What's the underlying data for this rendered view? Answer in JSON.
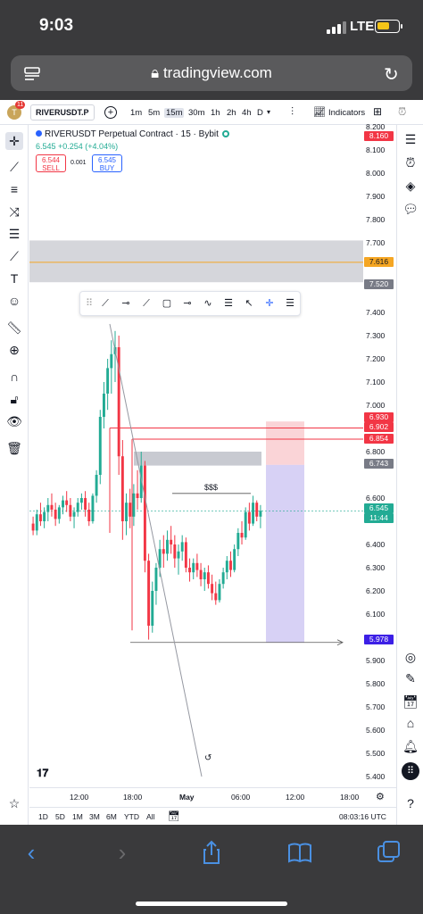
{
  "status_bar": {
    "time": "9:03",
    "network": "LTE"
  },
  "browser": {
    "url": "tradingview.com"
  },
  "toolbar": {
    "notifications": "11",
    "symbol": "RIVERUSDT.P",
    "timeframes": [
      "1m",
      "5m",
      "15m",
      "30m",
      "1h",
      "2h",
      "4h",
      "D"
    ],
    "active_timeframe": "15m",
    "indicators_label": "Indicators"
  },
  "legend": {
    "title": "RIVERUSDT Perpetual Contract · 15 · Bybit",
    "change": "6.545 +0.254 (+4.04%)",
    "sell_price": "6.544",
    "sell_label": "SELL",
    "spread": "0.001",
    "buy_price": "6.545",
    "buy_label": "BUY"
  },
  "price_axis": {
    "ticks": [
      "8.200",
      "8.100",
      "8.000",
      "7.900",
      "7.800",
      "7.700",
      "7.400",
      "7.300",
      "7.200",
      "7.100",
      "7.000",
      "6.800",
      "6.600",
      "6.400",
      "6.300",
      "6.200",
      "6.100",
      "5.900",
      "5.800",
      "5.700",
      "5.600",
      "5.500",
      "5.400"
    ],
    "labels": {
      "top": "8.160",
      "zone_line": "7.616",
      "zone_bottom": "7.520",
      "stop_1": "6.930",
      "stop_2": "6.902",
      "stop_3": "6.854",
      "entry": "6.743",
      "last": "6.545",
      "countdown": "11:44",
      "target": "5.978"
    }
  },
  "annotations": {
    "liquidity_label": "$$$"
  },
  "time_axis": {
    "labels": [
      "12:00",
      "18:00",
      "May",
      "06:00",
      "12:00",
      "18:00"
    ]
  },
  "bottom_bar": {
    "ranges": [
      "1D",
      "5D",
      "1M",
      "3M",
      "6M",
      "YTD",
      "All"
    ],
    "clock": "08:03:16 UTC"
  },
  "colors": {
    "up": "#22ab94",
    "down": "#f23645",
    "accent": "#2962ff",
    "zone_orange": "#f5a623",
    "entry_gray": "#787b86",
    "target_blue": "#3c1fe6"
  },
  "chart_data": {
    "type": "candlestick",
    "symbol": "RIVERUSDT Perpetual Contract",
    "interval": "15",
    "exchange": "Bybit",
    "x_labels": [
      "12:00",
      "18:00",
      "May",
      "06:00",
      "12:00",
      "18:00"
    ],
    "y_range": [
      5.38,
      8.22
    ],
    "last_price": 6.545,
    "ohlc_trace": [
      [
        6.49,
        6.52,
        6.44,
        6.46
      ],
      [
        6.46,
        6.55,
        6.44,
        6.53
      ],
      [
        6.53,
        6.58,
        6.48,
        6.5
      ],
      [
        6.5,
        6.56,
        6.47,
        6.54
      ],
      [
        6.54,
        6.6,
        6.5,
        6.57
      ],
      [
        6.57,
        6.62,
        6.52,
        6.55
      ],
      [
        6.55,
        6.58,
        6.48,
        6.51
      ],
      [
        6.51,
        6.57,
        6.49,
        6.56
      ],
      [
        6.56,
        6.61,
        6.53,
        6.59
      ],
      [
        6.59,
        6.63,
        6.54,
        6.57
      ],
      [
        6.57,
        6.6,
        6.5,
        6.52
      ],
      [
        6.52,
        6.56,
        6.47,
        6.54
      ],
      [
        6.54,
        6.6,
        6.52,
        6.58
      ],
      [
        6.58,
        6.62,
        6.55,
        6.6
      ],
      [
        6.6,
        6.63,
        6.52,
        6.55
      ],
      [
        6.55,
        6.58,
        6.48,
        6.5
      ],
      [
        6.5,
        6.62,
        6.49,
        6.61
      ],
      [
        6.61,
        6.72,
        6.58,
        6.7
      ],
      [
        6.7,
        6.98,
        6.66,
        6.95
      ],
      [
        6.95,
        7.1,
        6.9,
        7.05
      ],
      [
        7.05,
        7.2,
        6.98,
        7.16
      ],
      [
        7.16,
        7.28,
        7.05,
        7.22
      ],
      [
        7.22,
        7.32,
        7.1,
        7.25
      ],
      [
        7.25,
        7.3,
        6.7,
        6.78
      ],
      [
        6.78,
        6.85,
        6.42,
        6.5
      ],
      [
        6.5,
        6.62,
        6.44,
        6.58
      ],
      [
        6.58,
        6.64,
        6.47,
        6.52
      ],
      [
        6.52,
        6.66,
        6.48,
        6.62
      ],
      [
        6.62,
        6.72,
        6.55,
        6.6
      ],
      [
        6.6,
        6.8,
        6.58,
        6.74
      ],
      [
        6.74,
        6.76,
        6.28,
        6.33
      ],
      [
        6.33,
        6.36,
        5.99,
        6.05
      ],
      [
        6.05,
        6.24,
        6.02,
        6.2
      ],
      [
        6.2,
        6.32,
        6.14,
        6.3
      ],
      [
        6.3,
        6.42,
        6.26,
        6.38
      ],
      [
        6.38,
        6.44,
        6.3,
        6.36
      ],
      [
        6.36,
        6.46,
        6.33,
        6.42
      ],
      [
        6.42,
        6.48,
        6.36,
        6.4
      ],
      [
        6.4,
        6.44,
        6.3,
        6.34
      ],
      [
        6.34,
        6.4,
        6.27,
        6.37
      ],
      [
        6.37,
        6.44,
        6.33,
        6.41
      ],
      [
        6.41,
        6.43,
        6.28,
        6.3
      ],
      [
        6.3,
        6.34,
        6.24,
        6.28
      ],
      [
        6.28,
        6.34,
        6.25,
        6.32
      ],
      [
        6.32,
        6.36,
        6.26,
        6.29
      ],
      [
        6.29,
        6.32,
        6.22,
        6.25
      ],
      [
        6.25,
        6.3,
        6.2,
        6.28
      ],
      [
        6.28,
        6.31,
        6.21,
        6.23
      ],
      [
        6.23,
        6.27,
        6.16,
        6.19
      ],
      [
        6.19,
        6.24,
        6.14,
        6.16
      ],
      [
        6.16,
        6.25,
        6.15,
        6.23
      ],
      [
        6.23,
        6.3,
        6.21,
        6.28
      ],
      [
        6.28,
        6.35,
        6.25,
        6.33
      ],
      [
        6.33,
        6.37,
        6.26,
        6.29
      ],
      [
        6.29,
        6.4,
        6.28,
        6.38
      ],
      [
        6.38,
        6.47,
        6.35,
        6.45
      ],
      [
        6.45,
        6.5,
        6.4,
        6.43
      ],
      [
        6.43,
        6.56,
        6.42,
        6.54
      ],
      [
        6.54,
        6.58,
        6.46,
        6.49
      ],
      [
        6.49,
        6.61,
        6.48,
        6.58
      ],
      [
        6.58,
        6.59,
        6.5,
        6.52
      ],
      [
        6.52,
        6.57,
        6.47,
        6.545
      ]
    ],
    "zones": [
      {
        "type": "supply",
        "top": 7.71,
        "bottom": 7.53,
        "line": 7.616
      },
      {
        "type": "entry_box",
        "top": 6.8,
        "bottom": 6.74
      }
    ],
    "levels": [
      6.93,
      6.902,
      6.854,
      6.743,
      6.62,
      5.978
    ],
    "position": {
      "entry": 6.743,
      "stop": 6.93,
      "target": 5.978
    }
  }
}
